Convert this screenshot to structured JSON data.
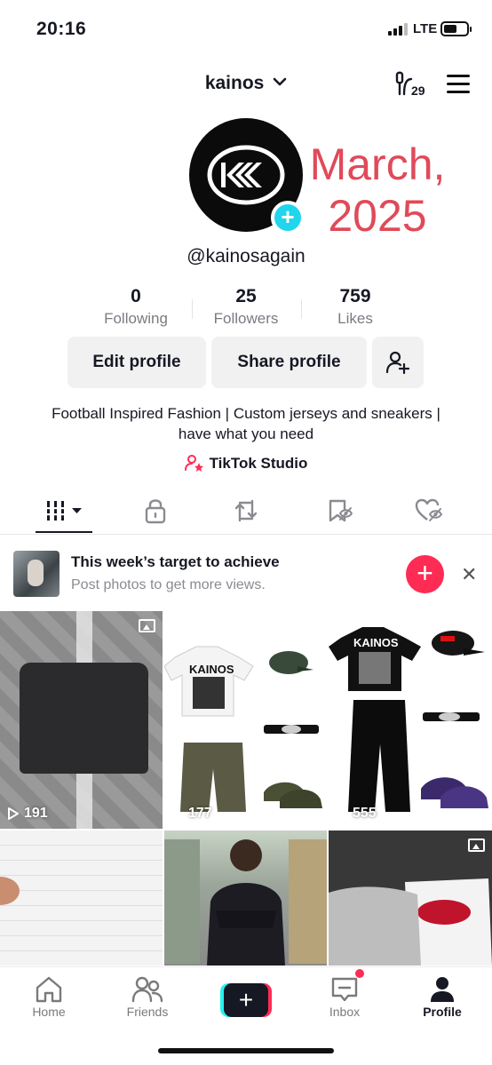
{
  "status_bar": {
    "time": "20:16",
    "network": "LTE"
  },
  "header": {
    "username": "kainos",
    "creator_badge": "29"
  },
  "overlay": {
    "line1": "March,",
    "line2": "2025"
  },
  "profile": {
    "handle": "@kainosagain",
    "stats": [
      {
        "value": "0",
        "label": "Following"
      },
      {
        "value": "25",
        "label": "Followers"
      },
      {
        "value": "759",
        "label": "Likes"
      }
    ],
    "edit_label": "Edit profile",
    "share_label": "Share profile",
    "bio": "Football Inspired Fashion | Custom jerseys and sneakers | have what you need",
    "studio_label": "TikTok Studio"
  },
  "tabs": [
    "videos-grid-icon",
    "lock-icon",
    "repost-icon",
    "saved-icon",
    "liked-icon"
  ],
  "target": {
    "title": "This week’s target to achieve",
    "subtitle": "Post photos to get more views."
  },
  "grid": [
    {
      "views": "191",
      "type": "photo"
    },
    {
      "views": "177",
      "type": "video",
      "tee_text": "KAINOS"
    },
    {
      "views": "555",
      "type": "video",
      "tee_text": "KAINOS"
    },
    {
      "views": "",
      "type": "video"
    },
    {
      "views": "",
      "type": "video"
    },
    {
      "views": "",
      "type": "photo"
    }
  ],
  "nav": {
    "home": "Home",
    "friends": "Friends",
    "inbox": "Inbox",
    "profile": "Profile"
  },
  "colors": {
    "accent": "#fe2c55",
    "cyan": "#25f4ee",
    "overlay_red": "#e04a59",
    "plus_badge": "#20d5ec"
  }
}
